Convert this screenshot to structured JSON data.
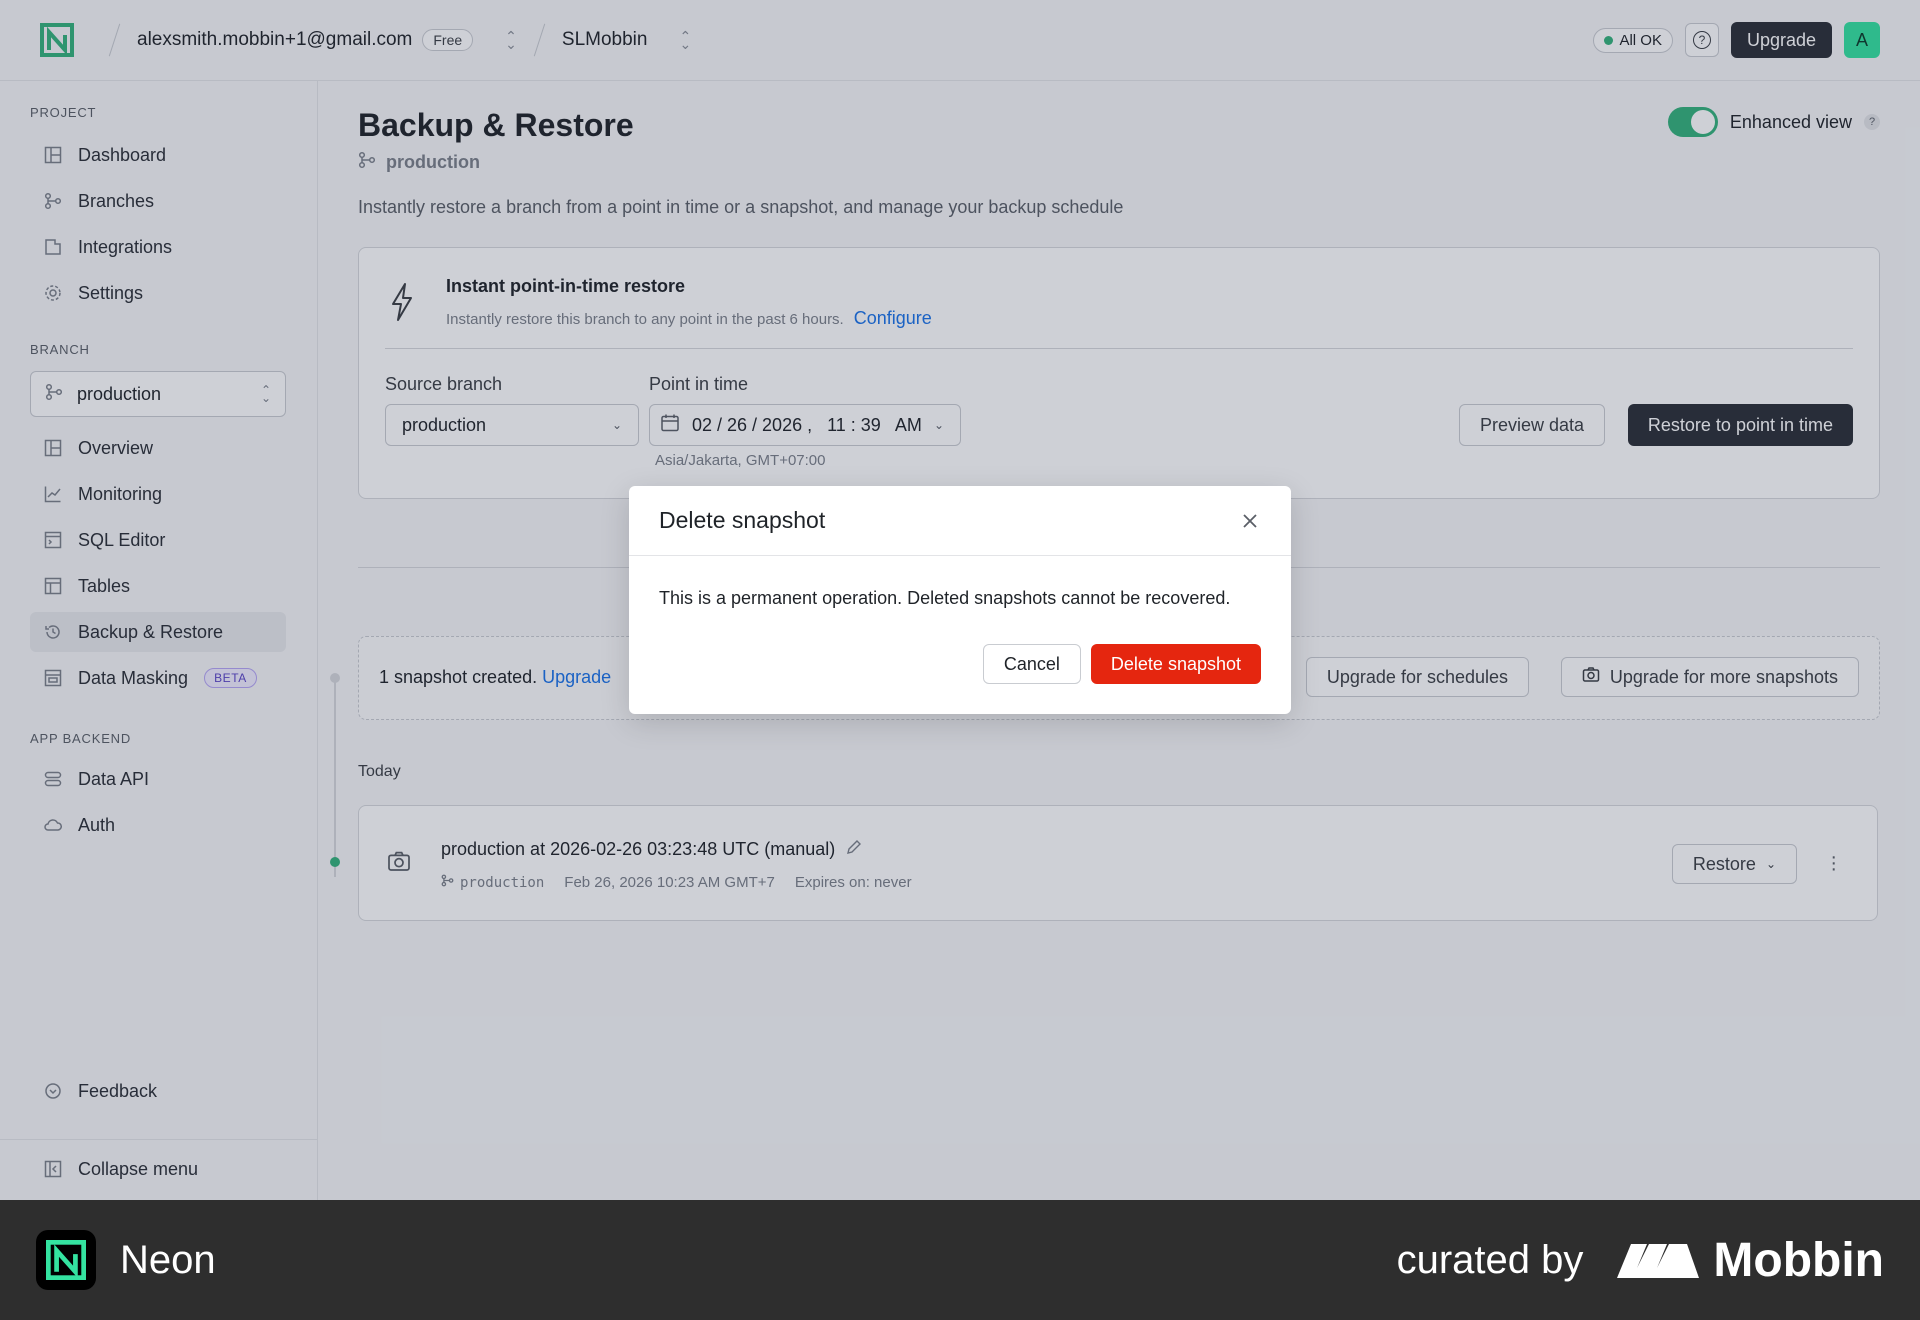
{
  "topbar": {
    "account": "alexsmith.mobbin+1@gmail.com",
    "plan_badge": "Free",
    "project": "SLMobbin",
    "status": "All OK",
    "help": "?",
    "upgrade_label": "Upgrade",
    "avatar_letter": "A"
  },
  "sidebar": {
    "project_section": "PROJECT",
    "project_items": [
      {
        "label": "Dashboard",
        "icon": "dashboard-icon"
      },
      {
        "label": "Branches",
        "icon": "branches-icon"
      },
      {
        "label": "Integrations",
        "icon": "integrations-icon"
      },
      {
        "label": "Settings",
        "icon": "gear-icon"
      }
    ],
    "branch_section": "BRANCH",
    "branch_select": "production",
    "branch_items": [
      {
        "label": "Overview",
        "icon": "overview-icon"
      },
      {
        "label": "Monitoring",
        "icon": "chart-icon"
      },
      {
        "label": "SQL Editor",
        "icon": "sql-editor-icon"
      },
      {
        "label": "Tables",
        "icon": "table-icon"
      },
      {
        "label": "Backup & Restore",
        "icon": "history-icon"
      },
      {
        "label": "Data Masking",
        "icon": "masking-icon",
        "badge": "BETA"
      }
    ],
    "backend_section": "APP BACKEND",
    "backend_items": [
      {
        "label": "Data API",
        "icon": "api-icon"
      },
      {
        "label": "Auth",
        "icon": "cloud-lock-icon"
      }
    ],
    "feedback": "Feedback",
    "collapse": "Collapse menu"
  },
  "main": {
    "title": "Backup & Restore",
    "branch": "production",
    "description": "Instantly restore a branch from a point in time or a snapshot, and manage your backup schedule",
    "enhanced_view": "Enhanced view",
    "enhanced_help": "?",
    "pitr": {
      "title": "Instant point-in-time restore",
      "hint": "Instantly restore this branch to any point in the past 6 hours.",
      "configure": "Configure",
      "source_label": "Source branch",
      "source_value": "production",
      "pit_label": "Point in time",
      "pit_value": "02 / 26 / 2026 ,   11 : 39   AM",
      "timezone": "Asia/Jakarta, GMT+07:00",
      "preview": "Preview data",
      "restore": "Restore to point in time"
    },
    "snapshots": {
      "created": "1 snapshot created.",
      "upgrade_link": "Upgrade",
      "upgrade_schedules": "Upgrade for schedules",
      "upgrade_more": "Upgrade for more snapshots",
      "group": "Today",
      "item_title": "production at 2026-02-26 03:23:48 UTC (manual)",
      "item_branch": "production",
      "item_date": "Feb 26, 2026 10:23 AM GMT+7",
      "item_expires": "Expires on: never",
      "restore": "Restore"
    }
  },
  "modal": {
    "title": "Delete snapshot",
    "body": "This is a permanent operation. Deleted snapshots cannot be recovered.",
    "cancel": "Cancel",
    "confirm": "Delete snapshot"
  },
  "footer": {
    "app": "Neon",
    "curated": "curated by",
    "brand": "Mobbin"
  },
  "colors": {
    "accent": "#34b27b",
    "danger": "#e5260f",
    "link": "#1a73e8",
    "dark": "#2b2f36"
  }
}
